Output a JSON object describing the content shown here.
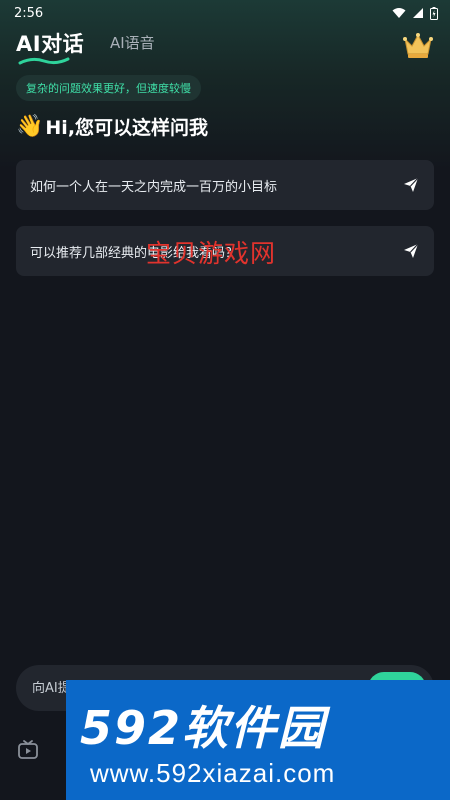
{
  "status_bar": {
    "time": "2:56"
  },
  "header": {
    "tab_ai_chat": "AI对话",
    "tab_ai_voice": "AI语音"
  },
  "hint_badge": "复杂的问题效果更好，但速度较慢",
  "greeting": {
    "emoji": "👋",
    "text": "Hi,您可以这样问我"
  },
  "suggestions": [
    {
      "text": "如何一个人在一天之内完成一百万的小目标"
    },
    {
      "text": "可以推荐几部经典的电影给我看吗？"
    }
  ],
  "watermark": "宝贝游戏网",
  "input": {
    "placeholder": "向AI提问"
  },
  "ad_banner": {
    "title": "592软件园",
    "url": "www.592xiazai.com"
  },
  "colors": {
    "accent": "#2fd39b",
    "hint_text": "#3fe0a8",
    "card_bg": "#22262e",
    "background": "#13161d",
    "watermark": "#e1332d",
    "ad_bg": "#0b68c8"
  }
}
